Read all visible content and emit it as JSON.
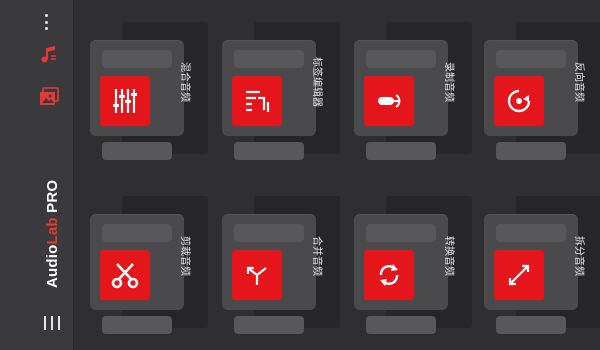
{
  "app": {
    "title_main": "Audio",
    "title_accent": "Lab",
    "title_suffix": " PRO"
  },
  "sidebar": {
    "icons": [
      "more-vertical-icon",
      "music-note-icon",
      "photo-gallery-icon",
      "menu-icon"
    ]
  },
  "colors": {
    "background": "#2f2f31",
    "tile_body": "#4a4a4d",
    "tile_panel": "#262628",
    "accent": "#e4161b",
    "icon_white": "#ffffff"
  },
  "tools": [
    {
      "label": "混合音频",
      "icon": "equalizer-sliders-icon"
    },
    {
      "label": "标签编辑器",
      "icon": "tag-editor-icon"
    },
    {
      "label": "录制音频",
      "icon": "microphone-icon"
    },
    {
      "label": "反向音频",
      "icon": "reverse-audio-icon"
    },
    {
      "label": "剪裁音频",
      "icon": "scissors-icon"
    },
    {
      "label": "合并音频",
      "icon": "merge-arrows-icon"
    },
    {
      "label": "转换音频",
      "icon": "convert-cycle-icon"
    },
    {
      "label": "拆分音频",
      "icon": "split-arrows-icon"
    }
  ]
}
